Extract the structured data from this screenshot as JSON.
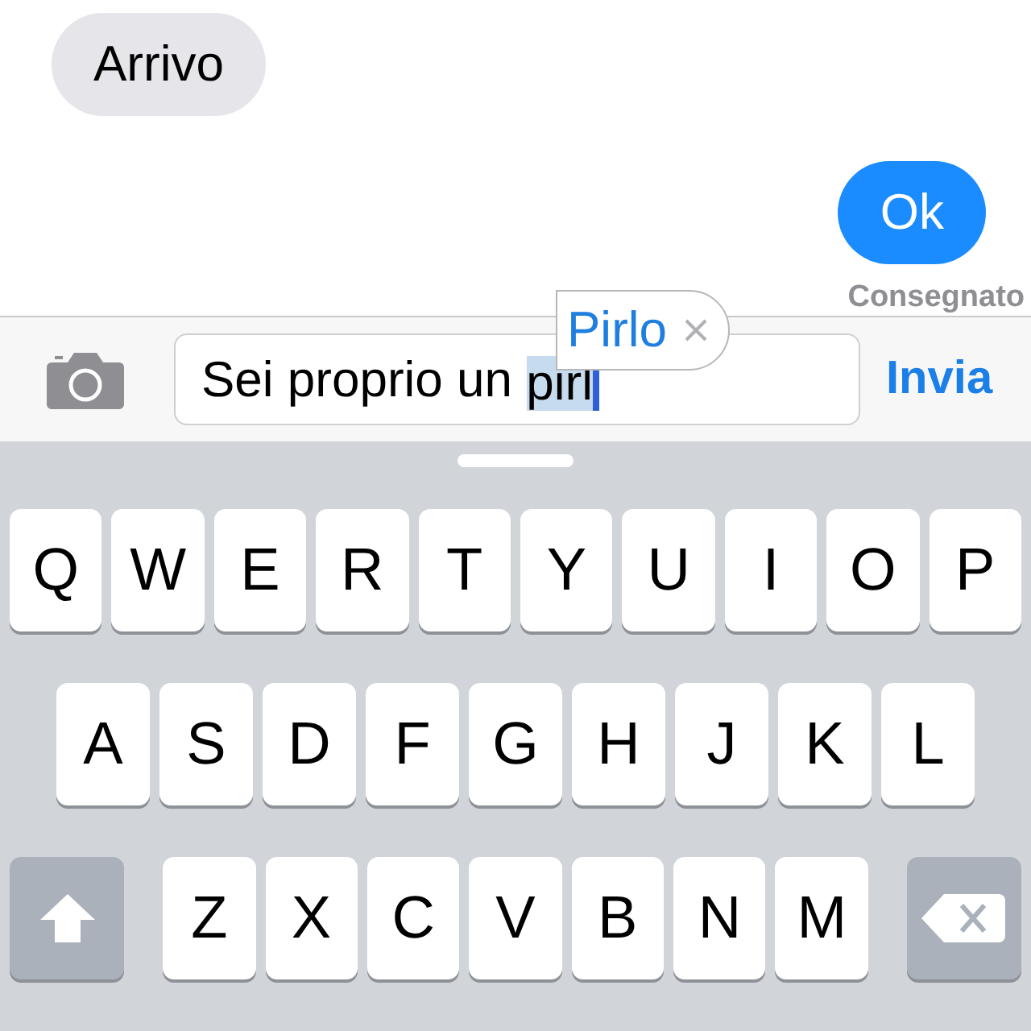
{
  "messages": [
    {
      "kind": "received",
      "text": "Arrivo"
    },
    {
      "kind": "sent",
      "text": "Ok"
    }
  ],
  "delivery_status": "Consegnato",
  "composer": {
    "text": "Sei proprio un ",
    "marked_text": "pirl",
    "send": "Invia"
  },
  "suggestion": {
    "text": "Pirlo"
  },
  "keyboard": {
    "rows": [
      {
        "keys": [
          {
            "kind": "letter",
            "label": "Q"
          },
          {
            "kind": "letter",
            "label": "W"
          },
          {
            "kind": "letter",
            "label": "E"
          },
          {
            "kind": "letter",
            "label": "R"
          },
          {
            "kind": "letter",
            "label": "T"
          },
          {
            "kind": "letter",
            "label": "Y"
          },
          {
            "kind": "letter",
            "label": "U"
          },
          {
            "kind": "letter",
            "label": "I"
          },
          {
            "kind": "letter",
            "label": "O"
          },
          {
            "kind": "letter",
            "label": "P"
          }
        ]
      },
      {
        "keys": [
          {
            "kind": "letter",
            "label": "A"
          },
          {
            "kind": "letter",
            "label": "S"
          },
          {
            "kind": "letter",
            "label": "D"
          },
          {
            "kind": "letter",
            "label": "F"
          },
          {
            "kind": "letter",
            "label": "G"
          },
          {
            "kind": "letter",
            "label": "H"
          },
          {
            "kind": "letter",
            "label": "J"
          },
          {
            "kind": "letter",
            "label": "K"
          },
          {
            "kind": "letter",
            "label": "L"
          }
        ]
      },
      {
        "keys": [
          {
            "kind": "shift"
          },
          {
            "kind": "letter",
            "label": "Z"
          },
          {
            "kind": "letter",
            "label": "X"
          },
          {
            "kind": "letter",
            "label": "C"
          },
          {
            "kind": "letter",
            "label": "V"
          },
          {
            "kind": "letter",
            "label": "B"
          },
          {
            "kind": "letter",
            "label": "N"
          },
          {
            "kind": "letter",
            "label": "M"
          },
          {
            "kind": "delete"
          }
        ]
      }
    ]
  }
}
